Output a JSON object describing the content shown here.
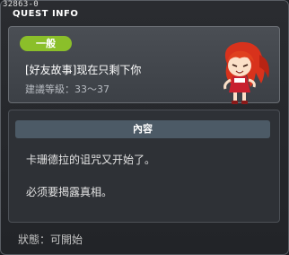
{
  "window": {
    "quest_id": "32863-0",
    "title": "QUEST INFO"
  },
  "quest": {
    "category": "一般",
    "name": "[好友故事]现在只剩下你",
    "level_label": "建議等級：",
    "level_range": "33～37"
  },
  "content": {
    "header": "內容",
    "lines": [
      "卡珊德拉的诅咒又开始了。",
      "必须要揭露真相。"
    ]
  },
  "status": {
    "label": "狀態：",
    "value": "可開始"
  },
  "colors": {
    "badge": "#8bbf2a",
    "hair": "#d8321c",
    "dress": "#c8202e"
  },
  "icons": {
    "npc": "npc-girl-red-hair-avatar"
  }
}
